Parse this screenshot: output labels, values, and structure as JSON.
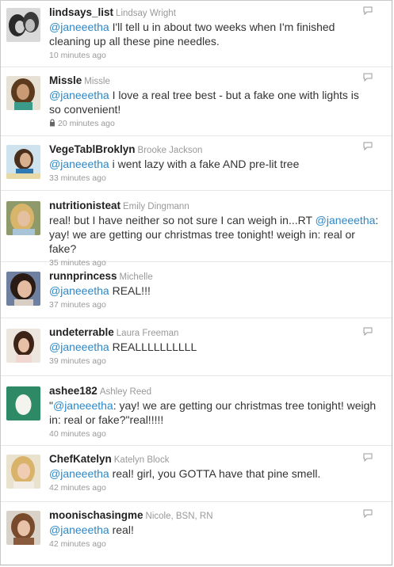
{
  "tweets": [
    {
      "screen_name": "lindsays_list",
      "full_name": "Lindsay Wright",
      "mention": "@janeeetha",
      "text": " I'll tell u in about two weeks when I'm finished cleaning up all these pine needles.",
      "time": "10 minutes ago",
      "locked": false,
      "reply": true,
      "avatar": "avatar-lindsay"
    },
    {
      "screen_name": "Missle",
      "full_name": "Missle",
      "mention": "@janeeetha",
      "text": " I love a real tree best - but a fake one with lights is so convenient!",
      "time": "20 minutes ago",
      "locked": true,
      "reply": true,
      "avatar": "avatar-missle"
    },
    {
      "screen_name": "VegeTablBroklyn",
      "full_name": "Brooke Jackson",
      "mention": "@janeeetha",
      "text": " i went lazy with a fake AND pre-lit tree",
      "time": "33 minutes ago",
      "locked": false,
      "reply": true,
      "avatar": "avatar-brooke"
    },
    {
      "screen_name": "nutritionisteat",
      "full_name": "Emily Dingmann",
      "pre": "real! but I have neither so not sure I can weigh in...RT ",
      "mention": "@janeeetha",
      "text": ": yay! we are getting our christmas tree tonight! weigh in: real or fake?",
      "time": "35 minutes ago",
      "locked": false,
      "reply": false,
      "avatar": "avatar-emily"
    },
    {
      "screen_name": "runnprincess",
      "full_name": "Michelle",
      "mention": "@janeeetha",
      "text": " REAL!!!",
      "time": "37 minutes ago",
      "locked": false,
      "reply": false,
      "avatar": "avatar-michelle"
    },
    {
      "screen_name": "undeterrable",
      "full_name": "Laura Freeman",
      "mention": "@janeeetha",
      "text": " REALLLLLLLLLL",
      "time": "39 minutes ago",
      "locked": false,
      "reply": true,
      "avatar": "avatar-laura"
    },
    {
      "screen_name": "ashee182",
      "full_name": "Ashley Reed",
      "pre": "\"",
      "mention": "@janeeetha",
      "text": ": yay! we are getting our christmas tree tonight! weigh in: real or fake?\"real!!!!!",
      "time": "40 minutes ago",
      "locked": false,
      "reply": false,
      "avatar": "avatar-egg"
    },
    {
      "screen_name": "ChefKatelyn",
      "full_name": "Katelyn Block",
      "mention": "@janeeetha",
      "text": " real! girl, you GOTTA have that pine smell.",
      "time": "42 minutes ago",
      "locked": false,
      "reply": true,
      "avatar": "avatar-katelyn"
    },
    {
      "screen_name": "moonischasingme",
      "full_name": "Nicole, BSN, RN",
      "mention": "@janeeetha",
      "text": " real!",
      "time": "42 minutes ago",
      "locked": false,
      "reply": true,
      "avatar": "avatar-nicole"
    }
  ],
  "colors": {
    "mention": "#2b88c8",
    "egg_bg": "#2e8a66"
  }
}
